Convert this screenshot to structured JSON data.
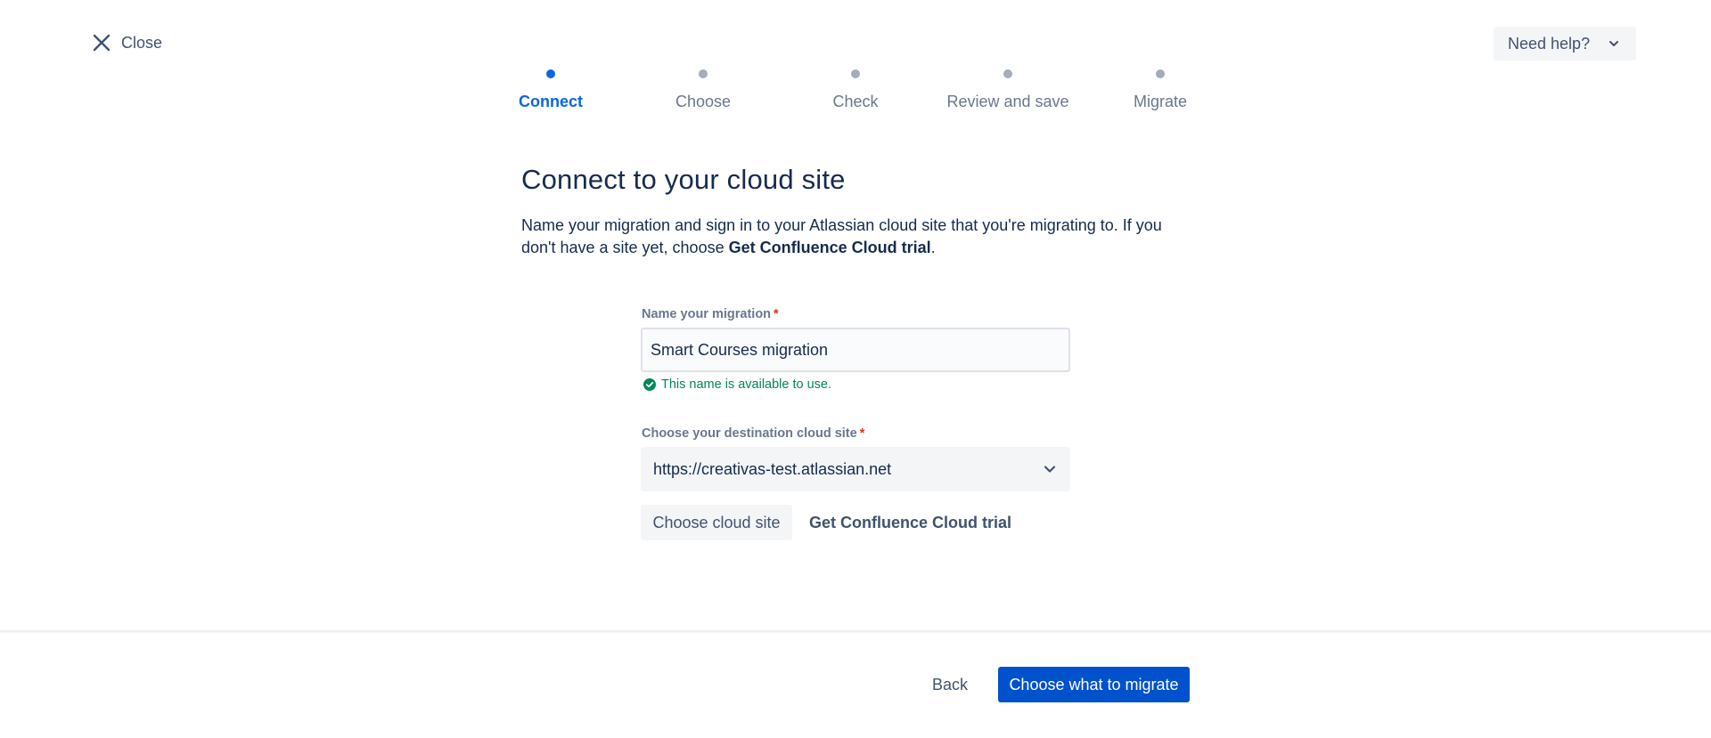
{
  "header": {
    "close_label": "Close",
    "help_label": "Need help?"
  },
  "stepper": {
    "steps": [
      {
        "label": "Connect",
        "active": true
      },
      {
        "label": "Choose",
        "active": false
      },
      {
        "label": "Check",
        "active": false
      },
      {
        "label": "Review and save",
        "active": false
      },
      {
        "label": "Migrate",
        "active": false
      }
    ]
  },
  "main": {
    "title": "Connect to your cloud site",
    "description_text": "Name your migration and sign in to your Atlassian cloud site that you're migrating to. If you don't have a site yet, choose ",
    "description_bold": "Get Confluence Cloud trial",
    "description_end": "."
  },
  "form": {
    "name_label": "Name your migration",
    "name_value": "Smart Courses migration",
    "name_valid_msg": "This name is available to use.",
    "site_label": "Choose your destination cloud site",
    "site_value": "https://creativas-test.atlassian.net",
    "required_mark": "*",
    "choose_site_label": "Choose cloud site",
    "trial_link_label": "Get Confluence Cloud trial"
  },
  "footer": {
    "back_label": "Back",
    "next_label": "Choose what to migrate"
  },
  "colors": {
    "primary": "#0052cc",
    "active_step": "#0c66e4",
    "success": "#00875a",
    "required": "#de350b"
  }
}
